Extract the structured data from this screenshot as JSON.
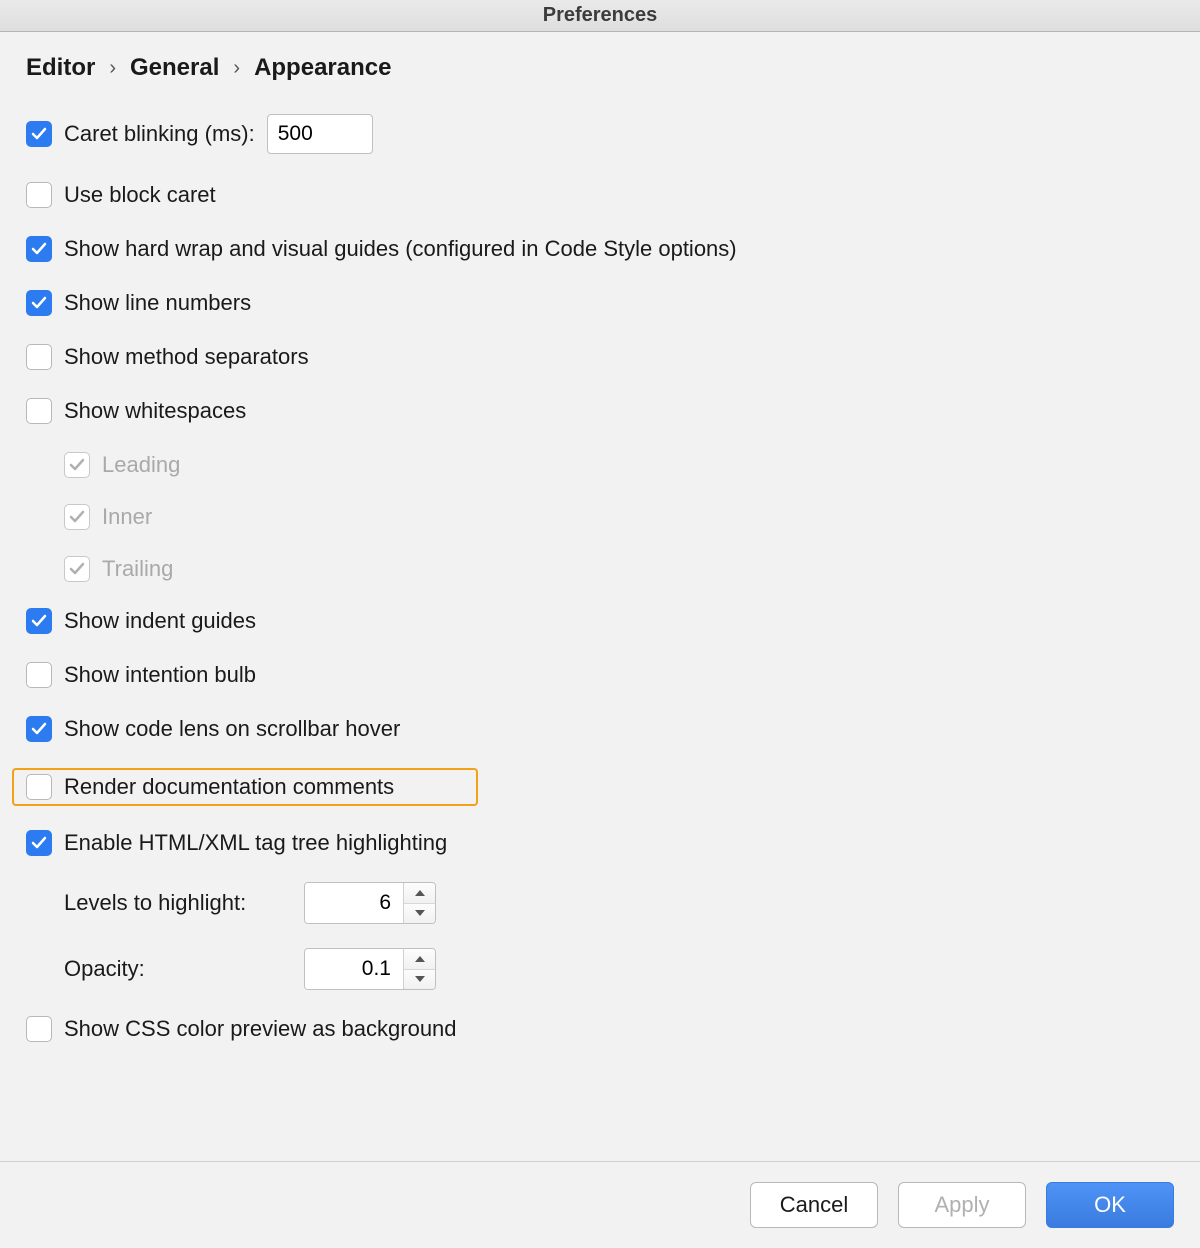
{
  "window": {
    "title": "Preferences"
  },
  "breadcrumb": [
    "Editor",
    "General",
    "Appearance"
  ],
  "opts": {
    "caret_blinking": {
      "label": "Caret blinking (ms):",
      "checked": true,
      "value": "500"
    },
    "use_block_caret": {
      "label": "Use block caret",
      "checked": false
    },
    "show_hard_wrap": {
      "label": "Show hard wrap and visual guides (configured in Code Style options)",
      "checked": true
    },
    "show_line_numbers": {
      "label": "Show line numbers",
      "checked": true
    },
    "show_method_separators": {
      "label": "Show method separators",
      "checked": false
    },
    "show_whitespaces": {
      "label": "Show whitespaces",
      "checked": false
    },
    "ws_leading": {
      "label": "Leading",
      "checked": true,
      "disabled": true
    },
    "ws_inner": {
      "label": "Inner",
      "checked": true,
      "disabled": true
    },
    "ws_trailing": {
      "label": "Trailing",
      "checked": true,
      "disabled": true
    },
    "show_indent_guides": {
      "label": "Show indent guides",
      "checked": true
    },
    "show_intention_bulb": {
      "label": "Show intention bulb",
      "checked": false
    },
    "show_code_lens": {
      "label": "Show code lens on scrollbar hover",
      "checked": true
    },
    "render_docs": {
      "label": "Render documentation comments",
      "checked": false
    },
    "enable_tag_tree": {
      "label": "Enable HTML/XML tag tree highlighting",
      "checked": true
    },
    "levels_to_highlight": {
      "label": "Levels to highlight:",
      "value": "6"
    },
    "opacity": {
      "label": "Opacity:",
      "value": "0.1"
    },
    "show_css_preview": {
      "label": "Show CSS color preview as background",
      "checked": false
    }
  },
  "buttons": {
    "cancel": "Cancel",
    "apply": "Apply",
    "ok": "OK"
  }
}
